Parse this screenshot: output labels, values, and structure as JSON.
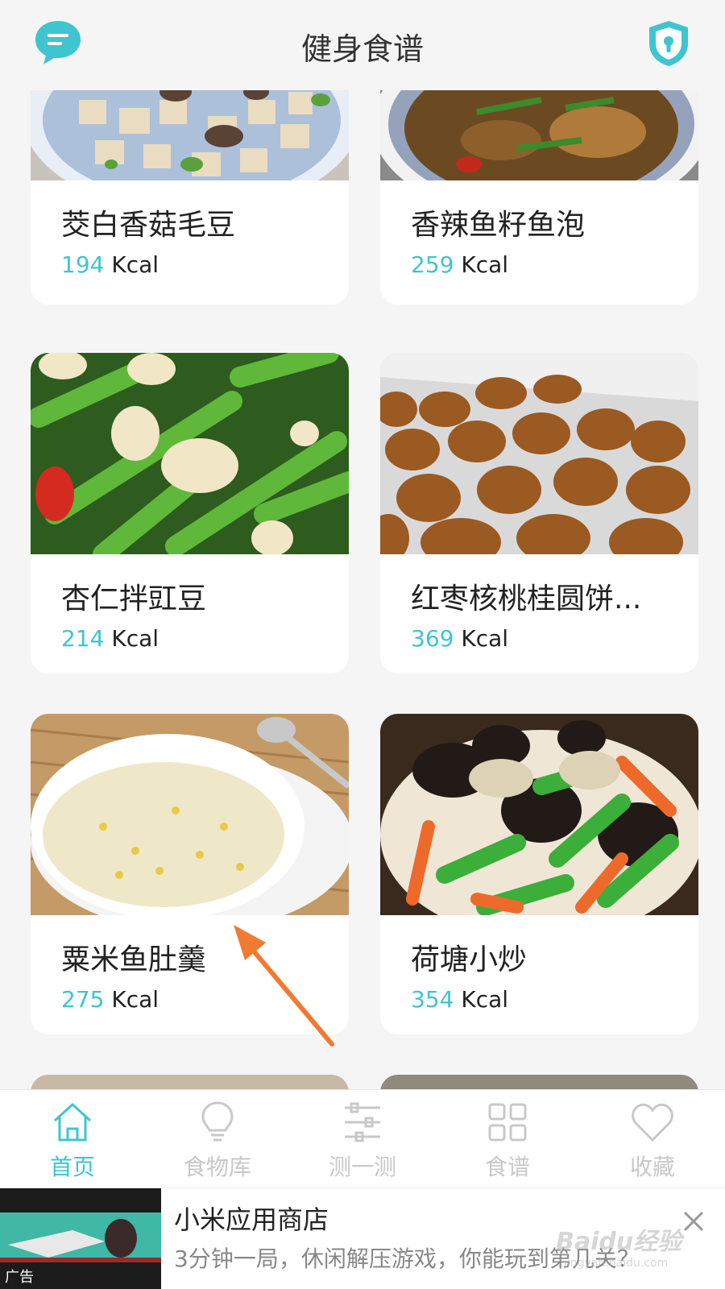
{
  "header": {
    "title": "健身食谱",
    "left_icon": "message-icon",
    "right_icon": "shield-lock-icon"
  },
  "accent_color": "#3ec5cf",
  "recipes": [
    {
      "name": "茭白香菇毛豆",
      "kcal": "194",
      "unit": "Kcal"
    },
    {
      "name": "香辣鱼籽鱼泡",
      "kcal": "259",
      "unit": "Kcal"
    },
    {
      "name": "杏仁拌豇豆",
      "kcal": "214",
      "unit": "Kcal"
    },
    {
      "name": "红枣核桃桂圆饼...",
      "kcal": "369",
      "unit": "Kcal"
    },
    {
      "name": "粟米鱼肚羹",
      "kcal": "275",
      "unit": "Kcal"
    },
    {
      "name": "荷塘小炒",
      "kcal": "354",
      "unit": "Kcal"
    }
  ],
  "tabs": [
    {
      "label": "首页",
      "icon": "home-icon",
      "active": true
    },
    {
      "label": "食物库",
      "icon": "lightbulb-icon",
      "active": false
    },
    {
      "label": "测一测",
      "icon": "sliders-icon",
      "active": false
    },
    {
      "label": "食谱",
      "icon": "grid-icon",
      "active": false
    },
    {
      "label": "收藏",
      "icon": "heart-icon",
      "active": false
    }
  ],
  "ad": {
    "label": "广告",
    "title": "小米应用商店",
    "description": "3分钟一局，休闲解压游戏，你能玩到第几关？"
  },
  "watermark": {
    "text": "Baidu经验",
    "sub": "jingyan.baidu.com"
  }
}
